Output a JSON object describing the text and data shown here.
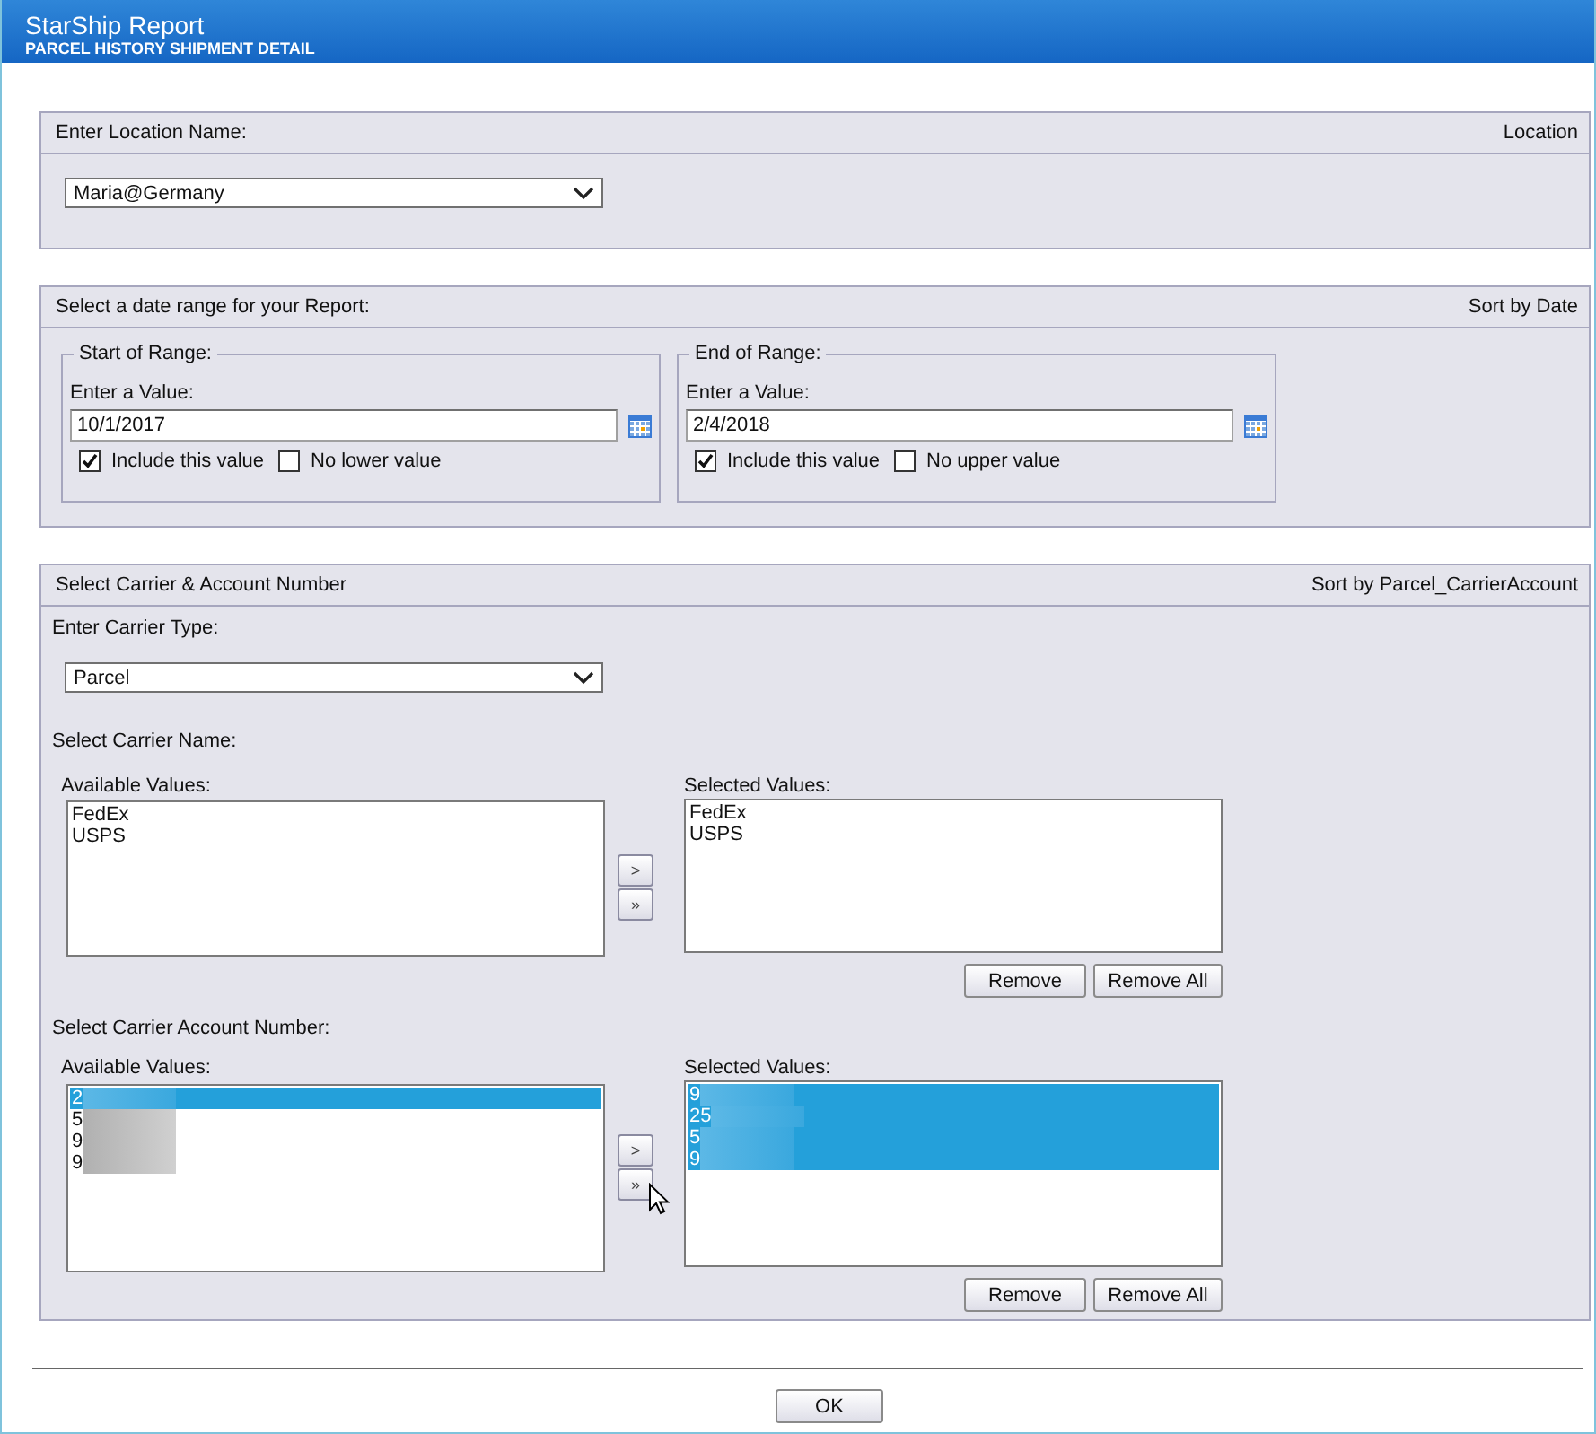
{
  "window": {
    "title": "StarShip Report",
    "subtitle": "PARCEL HISTORY SHIPMENT DETAIL"
  },
  "location": {
    "header": "Enter Location Name:",
    "sort_label": "Location",
    "value": "Maria@Germany"
  },
  "date_range": {
    "header": "Select a date range for your Report:",
    "sort_label": "Sort by Date",
    "ranges": [
      {
        "legend": "Start of Range:",
        "prompt": "Enter a Value:",
        "value": "10/1/2017",
        "options": [
          {
            "label": "Include this value",
            "checked": true
          },
          {
            "label": "No lower value",
            "checked": false
          }
        ]
      },
      {
        "legend": "End of Range:",
        "prompt": "Enter a Value:",
        "value": "2/4/2018",
        "options": [
          {
            "label": "Include this value",
            "checked": true
          },
          {
            "label": "No upper value",
            "checked": false
          }
        ]
      }
    ]
  },
  "carrier": {
    "header": "Select Carrier & Account Number",
    "sort_label": "Sort by Parcel_CarrierAccount",
    "type_label": "Enter Carrier Type:",
    "type_value": "Parcel",
    "pickers": [
      {
        "label": "Select Carrier Name:",
        "available_label": "Available Values:",
        "available": [
          {
            "text": "FedEx",
            "selected": false,
            "redacted": false
          },
          {
            "text": "USPS",
            "selected": false,
            "redacted": false
          }
        ],
        "move_buttons": [
          ">",
          "»"
        ],
        "selected_label": "Selected Values:",
        "chosen": [
          {
            "text": "FedEx",
            "selected": false,
            "redacted": false
          },
          {
            "text": "USPS",
            "selected": false,
            "redacted": false
          }
        ],
        "buttons": [
          "Remove",
          "Remove All"
        ]
      },
      {
        "label": "Select Carrier Account Number:",
        "available_label": "Available Values:",
        "available": [
          {
            "text": "2",
            "selected": true,
            "redacted": true
          },
          {
            "text": "5",
            "selected": false,
            "redacted": true
          },
          {
            "text": "9",
            "selected": false,
            "redacted": true
          },
          {
            "text": "9",
            "selected": false,
            "redacted": true
          }
        ],
        "move_buttons": [
          ">",
          "»"
        ],
        "selected_label": "Selected Values:",
        "chosen": [
          {
            "text": "9",
            "selected": true,
            "redacted": true
          },
          {
            "text": "25",
            "selected": true,
            "redacted": true
          },
          {
            "text": "5",
            "selected": true,
            "redacted": true
          },
          {
            "text": "9",
            "selected": true,
            "redacted": true
          }
        ],
        "buttons": [
          "Remove",
          "Remove All"
        ]
      }
    ]
  },
  "ok_button": "OK"
}
